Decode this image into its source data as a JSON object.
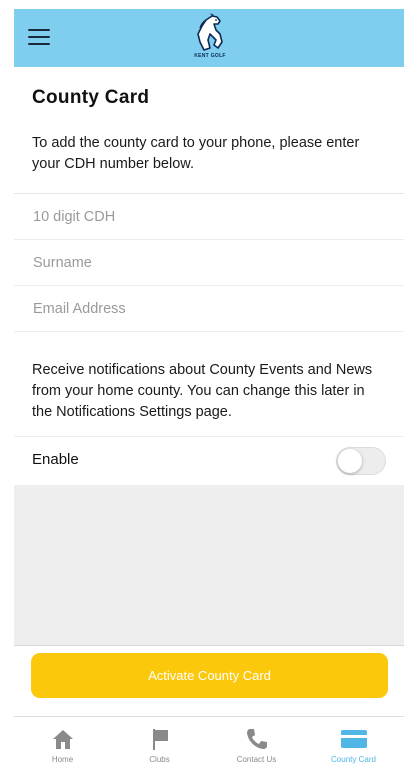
{
  "header": {
    "menu_icon": "hamburger-menu-icon",
    "logo_text": "KENT GOLF",
    "background": "#7fcdef"
  },
  "page": {
    "title": "County Card",
    "intro": "To add the county card to your phone, please enter your CDH number below."
  },
  "form": {
    "cdh_placeholder": "10 digit CDH",
    "surname_placeholder": "Surname",
    "email_placeholder": "Email Address"
  },
  "notifications": {
    "text": "Receive notifications about County Events and News from your home county. You can change this later in the Notifications Settings page.",
    "enable_label": "Enable",
    "enabled": false
  },
  "activate": {
    "label": "Activate County Card",
    "color": "#fcc80c"
  },
  "tabbar": {
    "tabs": [
      {
        "label": "Home",
        "icon": "home-icon",
        "active": false
      },
      {
        "label": "Clubs",
        "icon": "flag-icon",
        "active": false
      },
      {
        "label": "Contact Us",
        "icon": "phone-icon",
        "active": false
      },
      {
        "label": "County Card",
        "icon": "card-icon",
        "active": true
      }
    ],
    "active_color": "#4fb6e5"
  }
}
